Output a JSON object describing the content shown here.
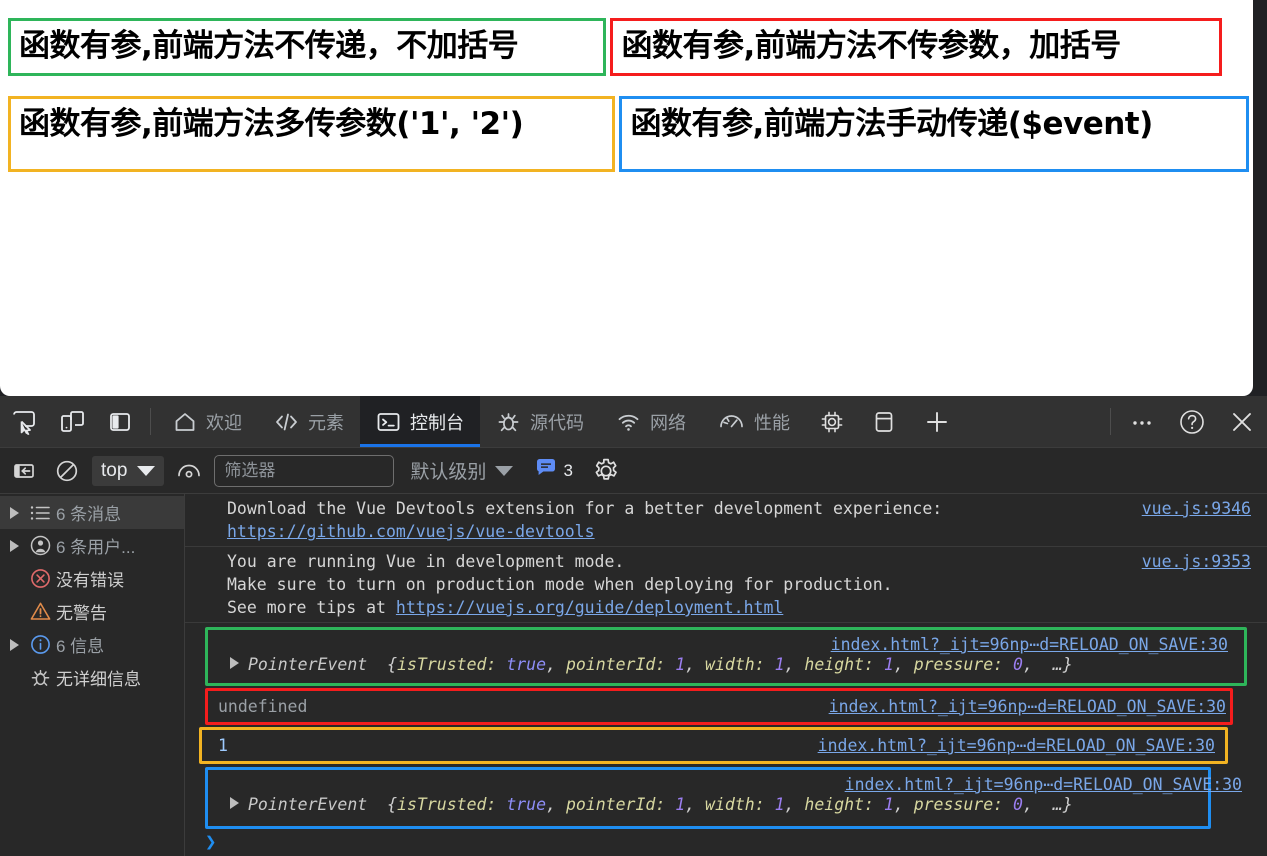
{
  "page": {
    "boxes": [
      {
        "text": "函数有参,前端方法不传递，不加括号",
        "color": "#2eb55a",
        "name": "no-parens"
      },
      {
        "text": "函数有参,前端方法不传参数，加括号",
        "color": "#f51d1d",
        "name": "with-parens"
      },
      {
        "text": "函数有参,前端方法多传参数('1', '2')",
        "color": "#f2b322",
        "name": "multi-args"
      },
      {
        "text": "函数有参,前端方法手动传递($event)",
        "color": "#1f8ef1",
        "name": "event-arg"
      }
    ]
  },
  "devtools": {
    "dock_buttons": [
      {
        "name": "inspect-element-icon",
        "title": "检查"
      },
      {
        "name": "device-toolbar-icon",
        "title": "设备工具栏"
      },
      {
        "name": "dock-side-icon",
        "title": "停靠侧边"
      }
    ],
    "tabs": [
      {
        "label": "欢迎",
        "icon": "home-icon",
        "active": false
      },
      {
        "label": "元素",
        "icon": "code-brackets-icon",
        "active": false
      },
      {
        "label": "控制台",
        "icon": "console-terminal-icon",
        "active": true
      },
      {
        "label": "源代码",
        "icon": "bug-icon",
        "active": false
      },
      {
        "label": "网络",
        "icon": "wifi-icon",
        "active": false
      },
      {
        "label": "性能",
        "icon": "gauge-icon",
        "active": false
      }
    ],
    "extra_tabs": [
      {
        "label": "",
        "icon": "memory-chip-icon"
      },
      {
        "label": "",
        "icon": "database-icon"
      },
      {
        "label": "",
        "icon": "plus-icon"
      }
    ],
    "right_buttons": [
      {
        "name": "more-options-icon",
        "glyph": "⋯"
      },
      {
        "name": "help-icon",
        "glyph": "?"
      },
      {
        "name": "close-icon",
        "glyph": "✕"
      }
    ],
    "filterbar": {
      "sidebar_toggle": "console-sidebar-toggle-icon",
      "clear_console": "clear-console-icon",
      "context": "top",
      "eye_icon": "live-expression-icon",
      "filter_placeholder": "筛选器",
      "filter_value": "",
      "level": "默认级别",
      "issues_count": "3",
      "settings": "settings-gear-icon"
    },
    "sidebar": [
      {
        "label": "6 条消息",
        "icon": "messages-list-icon",
        "arrow": true,
        "selected": true,
        "dim": true
      },
      {
        "label": "6 条用户...",
        "icon": "user-message-icon",
        "arrow": true,
        "selected": false,
        "dim": true
      },
      {
        "label": "没有错误",
        "icon": "error-circle-icon",
        "arrow": false,
        "selected": false,
        "dim": false
      },
      {
        "label": "无警告",
        "icon": "warning-triangle-icon",
        "arrow": false,
        "selected": false,
        "dim": false
      },
      {
        "label": "6 信息",
        "icon": "info-circle-icon",
        "arrow": true,
        "selected": false,
        "dim": true
      },
      {
        "label": "无详细信息",
        "icon": "verbose-bug-icon",
        "arrow": false,
        "selected": false,
        "dim": false
      }
    ],
    "log": {
      "entry1": {
        "line1": "Download the Vue Devtools extension for a better development experience:",
        "link": "https://github.com/vuejs/vue-devtools",
        "source": "vue.js:9346"
      },
      "entry2": {
        "line1": "You are running Vue in development mode.",
        "line2": "Make sure to turn on production mode when deploying for production.",
        "line3_pre": "See more tips at ",
        "line3_link": "https://vuejs.org/guide/deployment.html",
        "source": "vue.js:9353"
      },
      "event_source": "index.html?_ijt=96np⋯d=RELOAD_ON_SAVE:30",
      "pointer_event": {
        "name": "PointerEvent",
        "open": "{",
        "k1": "isTrusted:",
        "v1": "true",
        "k2": "pointerId:",
        "v2": "1",
        "k3": "width:",
        "v3": "1",
        "k4": "height:",
        "v4": "1",
        "k5": "pressure:",
        "v5": "0",
        "ellipsis": "…}"
      },
      "undefined_value": "undefined",
      "number_value": "1"
    },
    "prompt": "❯"
  }
}
